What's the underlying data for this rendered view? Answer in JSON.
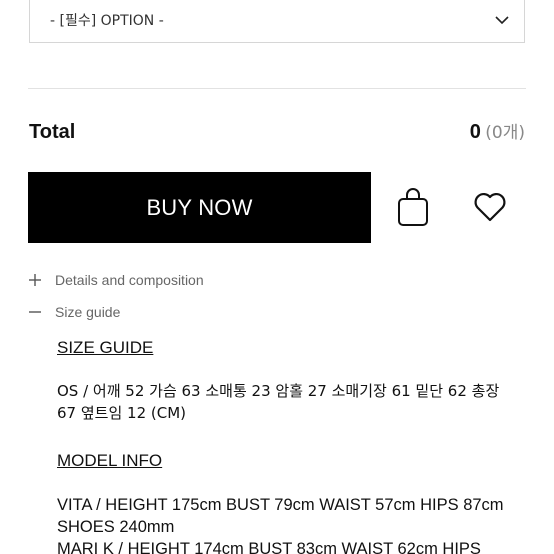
{
  "option": {
    "label": "- [필수] OPTION -"
  },
  "total": {
    "label": "Total",
    "amount": "0",
    "count": "(0개)"
  },
  "actions": {
    "buy_label": "BUY NOW"
  },
  "accordion": {
    "details_label": "Details and composition",
    "size_label": "Size guide"
  },
  "size_guide": {
    "heading": "SIZE GUIDE",
    "measurements": "OS / 어깨 52 가슴 63 소매통 23 암홀 27 소매기장 61 밑단 62 총장 67 옆트임 12 (CM)",
    "model_heading": "MODEL INFO",
    "model_1": "VITA / HEIGHT 175cm BUST 79cm WAIST 57cm HIPS 87cm SHOES 240mm",
    "model_2": "MARI K / HEIGHT 174cm BUST 83cm WAIST 62cm HIPS"
  },
  "icons": [
    "chevron-down-icon",
    "shopping-bag-icon",
    "heart-icon",
    "plus-icon",
    "minus-icon"
  ]
}
